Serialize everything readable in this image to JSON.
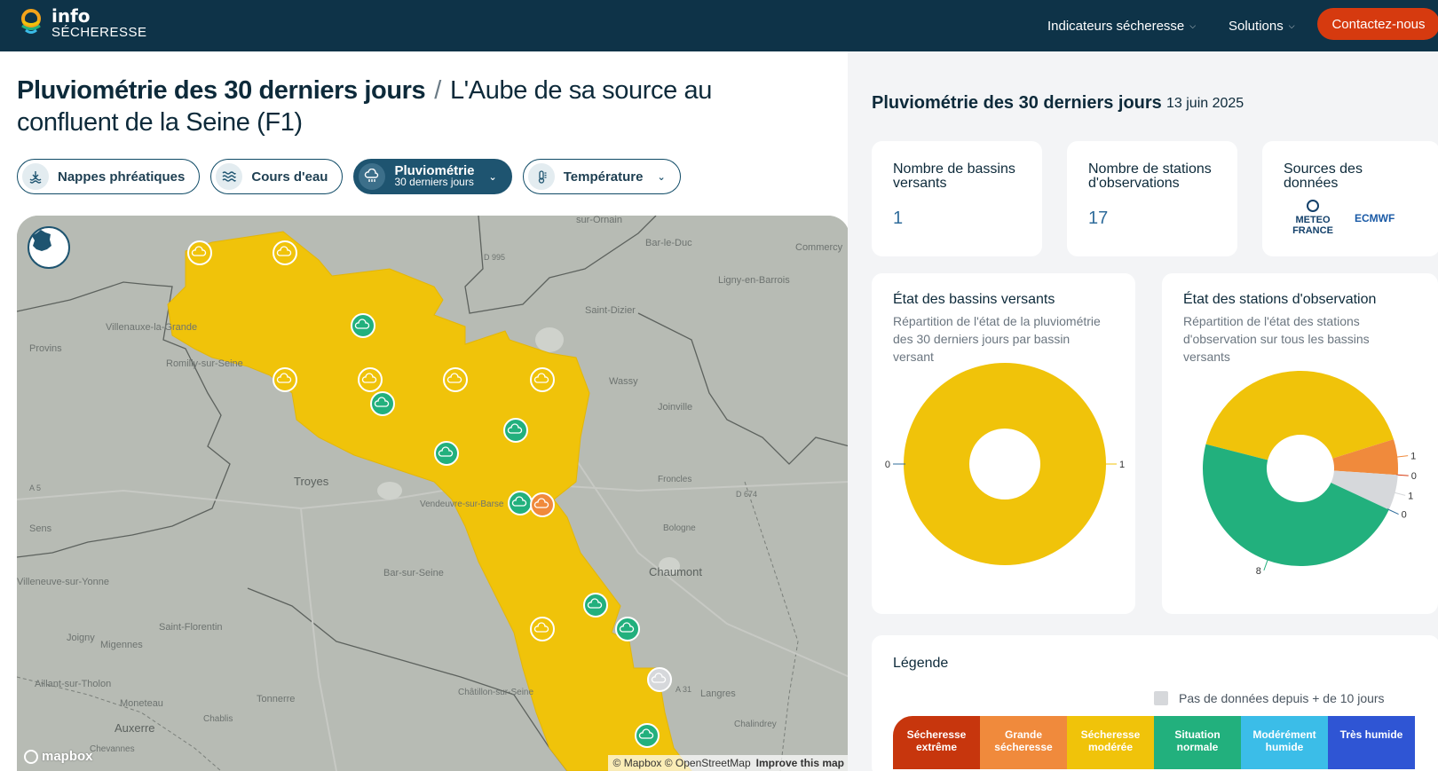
{
  "header": {
    "logo_line1": "info",
    "logo_line2": "SÉCHERESSE",
    "nav": [
      {
        "label": "Indicateurs sécheresse"
      },
      {
        "label": "Solutions"
      }
    ],
    "cta_label": "Contactez-nous"
  },
  "page": {
    "title_main": "Pluviométrie des 30 derniers jours",
    "title_separator": "/",
    "title_place": "L'Aube de sa source au confluent de la Seine (F1)"
  },
  "filters": [
    {
      "label": "Nappes phréatiques",
      "icon": "groundwater-icon"
    },
    {
      "label": "Cours d'eau",
      "icon": "waves-icon"
    },
    {
      "label": "Pluviométrie",
      "sublabel": "30 derniers jours",
      "icon": "rain-cloud-icon",
      "active": true
    },
    {
      "label": "Température",
      "icon": "thermometer-icon"
    }
  ],
  "map": {
    "places": [
      "sur-Ornain",
      "Bar-le-Duc",
      "Commercy",
      "Ligny-en-Barrois",
      "Saint-Dizier",
      "Villenauxe-la-Grande",
      "Provins",
      "Romilly-sur-Seine",
      "Wassy",
      "Joinville",
      "Troyes",
      "Vendeuvre-sur-Barse",
      "Sens",
      "Bar-sur-Seine",
      "Chaumont",
      "Bologne",
      "Villeneuve-sur-Yonne",
      "Saint-Florentin",
      "Joigny",
      "Migennes",
      "Aillant-sur-Tholon",
      "Moneteau",
      "Auxerre",
      "Tonnerre",
      "Chablis",
      "Châtillon-sur-Seine",
      "Langres",
      "Chalindrey",
      "Froncles",
      "Chevannes",
      "D 995",
      "D 674",
      "A 5",
      "A 31"
    ],
    "attribution": "© Mapbox © OpenStreetMap",
    "improve": "Improve this map",
    "mapbox": "mapbox",
    "colors": {
      "basin": "#f0c30a",
      "station_green": "#22b07d",
      "station_yellow": "#f0c30a",
      "station_orange": "#f08a3c",
      "station_grey": "#d6d8db"
    }
  },
  "summary": {
    "title": "Pluviométrie des 30 derniers jours",
    "date": "13 juin 2025",
    "cards": [
      {
        "label": "Nombre de bassins versants",
        "value": "1"
      },
      {
        "label": "Nombre de stations d'observations",
        "value": "17"
      },
      {
        "label": "Sources des données",
        "sources": [
          "METEO FRANCE",
          "ECMWF"
        ]
      }
    ]
  },
  "chart_data": [
    {
      "type": "pie",
      "title": "État des bassins versants",
      "subtitle": "Répartition de l'état de la pluviométrie des 30 derniers jours par bassin versant",
      "slices": [
        {
          "value": 1,
          "color": "#f0c30a"
        },
        {
          "value": 0,
          "color": "#2f6c9b"
        }
      ]
    },
    {
      "type": "pie",
      "title": "État des stations d'observation",
      "subtitle": "Répartition de l'état des stations d'observation sur tous les bassins versants",
      "slices": [
        {
          "value": 7,
          "color": "#f0c30a"
        },
        {
          "value": 1,
          "color": "#f08a3c"
        },
        {
          "value": 0,
          "color": "#d63a0f"
        },
        {
          "value": 1,
          "color": "#d6d8db"
        },
        {
          "value": 0,
          "color": "#2f6c9b"
        },
        {
          "value": 8,
          "color": "#22b07d"
        }
      ]
    }
  ],
  "legend": {
    "title": "Légende",
    "no_data": "Pas de données depuis + de 10 jours",
    "items": [
      {
        "label": "Sécheresse extrême",
        "color": "#c7360d"
      },
      {
        "label": "Grande sécheresse",
        "color": "#f08a3c"
      },
      {
        "label": "Sécheresse modérée",
        "color": "#f0c30a"
      },
      {
        "label": "Situation normale",
        "color": "#22b07d"
      },
      {
        "label": "Modérément humide",
        "color": "#3bbde8"
      },
      {
        "label": "Très humide",
        "color": "#2f55d4"
      }
    ]
  }
}
